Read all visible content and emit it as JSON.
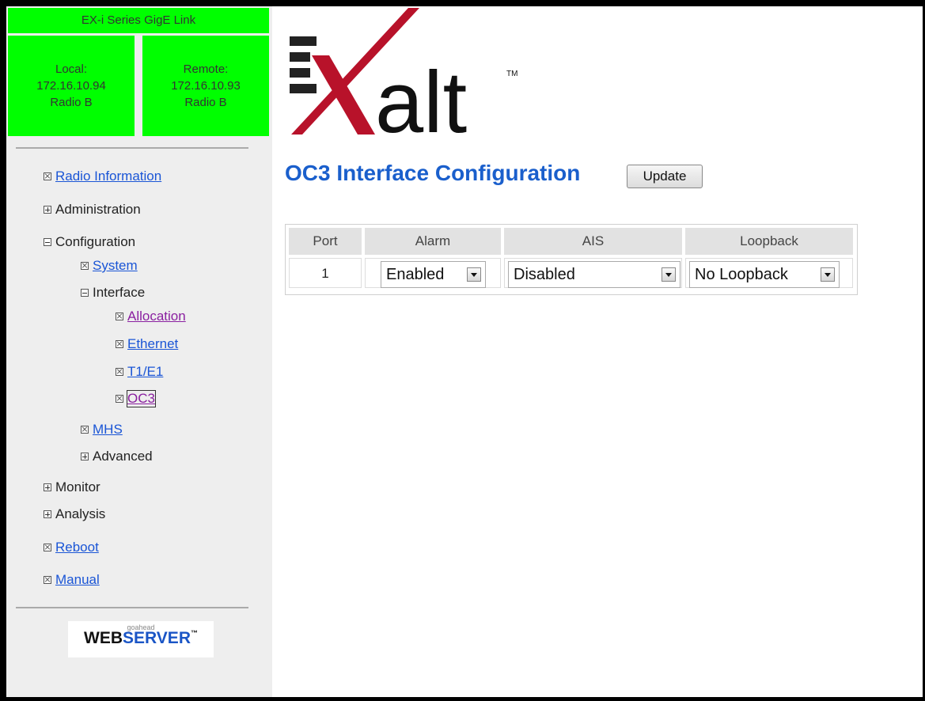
{
  "sidebar": {
    "banner": "EX-i Series GigE Link",
    "local": {
      "label": "Local:",
      "ip": "172.16.10.94",
      "radio": "Radio B"
    },
    "remote": {
      "label": "Remote:",
      "ip": "172.16.10.93",
      "radio": "Radio B"
    },
    "nav": {
      "radio_information": "Radio Information",
      "administration": "Administration",
      "configuration": "Configuration",
      "system": "System",
      "interface": "Interface",
      "allocation": "Allocation",
      "ethernet": "Ethernet",
      "t1e1": "T1/E1",
      "oc3": "OC3",
      "mhs": "MHS",
      "advanced": "Advanced",
      "monitor": "Monitor",
      "analysis": "Analysis",
      "reboot": "Reboot",
      "manual": "Manual"
    },
    "webserver": {
      "small": "goahead",
      "web": "WEB",
      "server": "SERVER",
      "tm": "™"
    }
  },
  "logo": {
    "text": "alt",
    "tm": "TM"
  },
  "page": {
    "title": "OC3 Interface Configuration",
    "update_label": "Update"
  },
  "table": {
    "headers": {
      "port": "Port",
      "alarm": "Alarm",
      "ais": "AIS",
      "loopback": "Loopback"
    },
    "row": {
      "port": "1",
      "alarm": "Enabled",
      "ais": "Disabled",
      "loopback": "No Loopback"
    }
  },
  "colors": {
    "banner_green": "#00ff00",
    "link": "#1a55d6",
    "visited": "#8a1fa0",
    "title": "#1a5fcc",
    "logo_red": "#b8122a"
  }
}
